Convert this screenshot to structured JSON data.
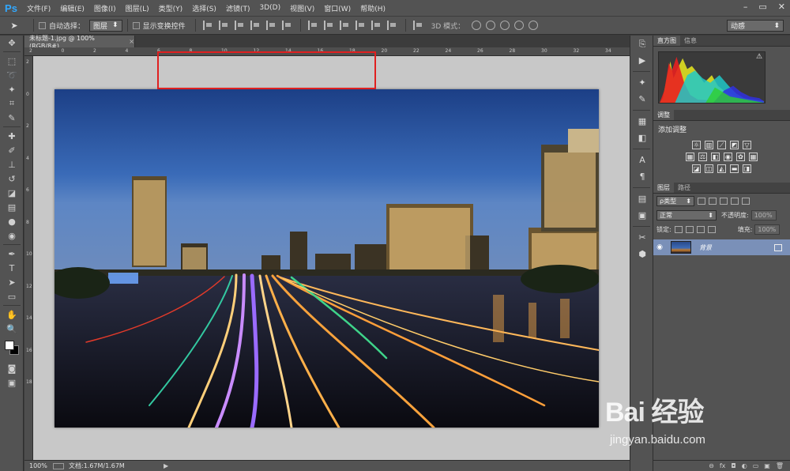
{
  "app": {
    "logo": "Ps"
  },
  "menu": [
    "文件(F)",
    "编辑(E)",
    "图像(I)",
    "图层(L)",
    "类型(Y)",
    "选择(S)",
    "滤镜(T)",
    "3D(D)",
    "视图(V)",
    "窗口(W)",
    "帮助(H)"
  ],
  "window_controls": {
    "minimize": "–",
    "restore": "▭",
    "close": "✕"
  },
  "options": {
    "auto_select_label": "自动选择：",
    "auto_select_value": "图层",
    "show_transform_label": "显示变换控件",
    "mode_3d_label": "3D 模式：",
    "workspace": "动感"
  },
  "document": {
    "tab_title": "未标题-1.jpg @ 100%(RGB/8#)",
    "ruler_top": [
      "2",
      "0",
      "2",
      "4",
      "6",
      "8",
      "10",
      "12",
      "14",
      "16",
      "18",
      "20",
      "22",
      "24",
      "26",
      "28",
      "30",
      "32",
      "34"
    ],
    "ruler_left": [
      "2",
      "0",
      "2",
      "4",
      "6",
      "8",
      "10",
      "12",
      "14",
      "16",
      "18"
    ]
  },
  "status": {
    "zoom": "100%",
    "doc_info": "文档:1.67M/1.67M",
    "arrow": "▶"
  },
  "panels": {
    "histogram_tabs": [
      "直方图",
      "信息"
    ],
    "histogram_warning": "⚠",
    "adjust_tab": "调整",
    "adjust_title": "添加调整",
    "layers_tabs": [
      "图层",
      "路径"
    ],
    "kind_filter": "ρ类型",
    "blend_mode": "正常",
    "opacity_label": "不透明度:",
    "opacity_value": "100%",
    "lock_label": "锁定:",
    "fill_label": "填充:",
    "fill_value": "100%",
    "layer_name": "背景",
    "footer_icons": [
      "⊖",
      "fx",
      "◘",
      "◐",
      "▭",
      "▣",
      "🗑"
    ]
  },
  "watermark": {
    "brand": "Bai 经验",
    "url": "jingyan.baidu.com"
  },
  "colors": {
    "highlight": "#e02020",
    "layer_selected": "#7a90b8",
    "ps_blue": "#31a8ff"
  }
}
